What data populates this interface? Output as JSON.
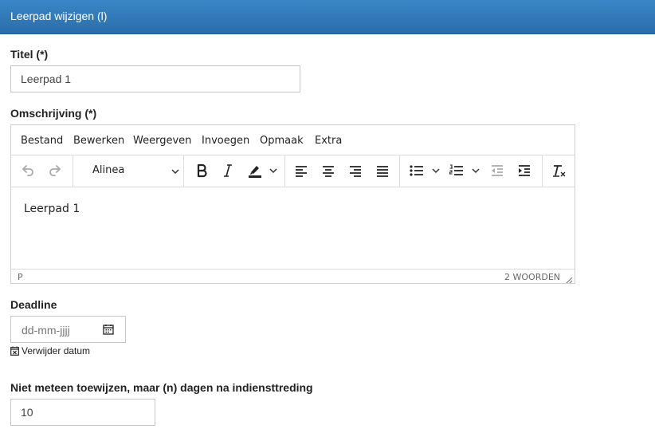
{
  "header": {
    "title": "Leerpad wijzigen (l)"
  },
  "form": {
    "title_label": "Titel (*)",
    "title_value": "Leerpad 1",
    "description_label": "Omschrijving (*)",
    "deadline_label": "Deadline",
    "deadline_placeholder": "dd-mm-jjjj",
    "remove_date_label": "Verwijder datum",
    "delay_label": "Niet meteen toewijzen, maar (n) dagen na indiensttreding",
    "delay_value": "10"
  },
  "editor": {
    "menu": [
      "Bestand",
      "Bewerken",
      "Weergeven",
      "Invoegen",
      "Opmaak",
      "Extra"
    ],
    "block_format": "Alinea",
    "content": "Leerpad 1",
    "status_path": "P",
    "word_count": "2 WOORDEN",
    "toolbar_icons": [
      "undo-icon",
      "redo-icon",
      "bold-icon",
      "italic-icon",
      "highlight-icon",
      "align-left-icon",
      "align-center-icon",
      "align-right-icon",
      "align-justify-icon",
      "bullet-list-icon",
      "numbered-list-icon",
      "outdent-icon",
      "indent-icon",
      "clear-formatting-icon"
    ]
  },
  "colors": {
    "header_bg": "#2f78b8",
    "border": "#c6c6c6",
    "text": "#222222"
  }
}
